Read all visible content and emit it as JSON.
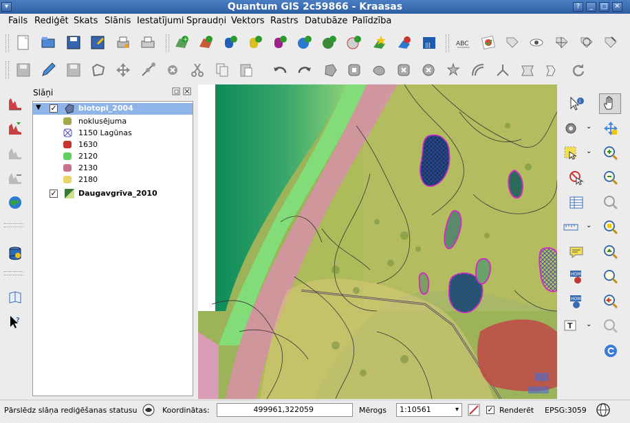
{
  "window": {
    "title": "Quantum GIS 2c59866 - Kraasas",
    "buttons": [
      "menu",
      "help",
      "minimize",
      "maximize",
      "close"
    ]
  },
  "menu": [
    "Fails",
    "Rediģēt",
    "Skats",
    "Slānis",
    "Iestatījumi",
    "Spraudņi",
    "Vektors",
    "Rastrs",
    "Datubāze",
    "Palīdzība"
  ],
  "layers_panel": {
    "title": "Slāņi",
    "layers": [
      {
        "name": "biotopi_2004",
        "checked": true,
        "selected": true,
        "classes": [
          {
            "label": "noklusējuma",
            "color": "#a5a84a"
          },
          {
            "label": "1150 Lagūnas",
            "color": "#4a44b8"
          },
          {
            "label": "1630",
            "color": "#c8322f"
          },
          {
            "label": "2120",
            "color": "#60d060"
          },
          {
            "label": "2130",
            "color": "#c87090"
          },
          {
            "label": "2180",
            "color": "#e8d46a"
          }
        ]
      },
      {
        "name": "Daugavgrīva_2010",
        "checked": true,
        "selected": false,
        "classes": []
      }
    ]
  },
  "status": {
    "toggle_edit_label": "Pārslēdz slāņa rediģēšanas statusu",
    "coords_label": "Koordinātas:",
    "coords_value": "499961,322059",
    "scale_label": "Mērogs",
    "scale_value": "1:10561",
    "render_label": "Renderēt",
    "render_checked": true,
    "crs": "EPSG:3059"
  }
}
